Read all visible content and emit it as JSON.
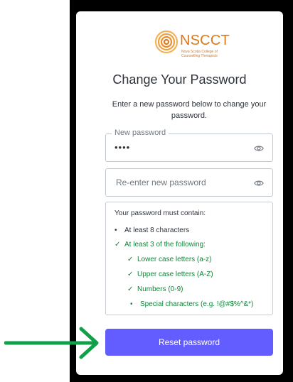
{
  "logo": {
    "name": "NSCCT",
    "subtitle_line1": "Nova Scotia College of",
    "subtitle_line2": "Counselling Therapists",
    "color": "#e07a18"
  },
  "page": {
    "title": "Change Your Password",
    "subtitle": "Enter a new password below to change your password."
  },
  "new_password": {
    "label": "New password",
    "value": "••••",
    "icon": "eye-icon"
  },
  "reenter_password": {
    "placeholder": "Re-enter new password",
    "value": "",
    "icon": "eye-icon"
  },
  "requirements": {
    "header": "Your password must contain:",
    "items": [
      {
        "mark": "•",
        "text": "At least 8 characters",
        "status": "neutral"
      },
      {
        "mark": "✓",
        "text": "At least 3 of the following:",
        "status": "ok"
      },
      {
        "mark": "✓",
        "text": "Lower case letters (a-z)",
        "status": "ok"
      },
      {
        "mark": "✓",
        "text": "Upper case letters (A-Z)",
        "status": "ok"
      },
      {
        "mark": "✓",
        "text": "Numbers (0-9)",
        "status": "ok"
      },
      {
        "mark": "•",
        "text": "Special characters (e.g. !@#$%^&*)",
        "status": "ok"
      }
    ]
  },
  "submit": {
    "label": "Reset password",
    "color": "#635dff"
  },
  "annotation": {
    "icon": "green-arrow-icon",
    "color": "#0fa14a"
  }
}
